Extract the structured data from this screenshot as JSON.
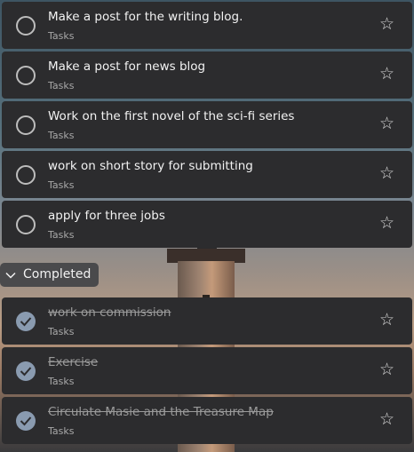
{
  "open_tasks": [
    {
      "title": "Make a post for the writing blog.",
      "list": "Tasks"
    },
    {
      "title": "Make a post for news blog",
      "list": "Tasks"
    },
    {
      "title": "Work on the first novel of the sci-fi series",
      "list": "Tasks"
    },
    {
      "title": "work on short story for submitting",
      "list": "Tasks"
    },
    {
      "title": "apply for three jobs",
      "list": "Tasks"
    }
  ],
  "completed_section": {
    "label": "Completed"
  },
  "completed_tasks": [
    {
      "title": "work on commission",
      "list": "Tasks"
    },
    {
      "title": "Exercise",
      "list": "Tasks"
    },
    {
      "title": "Circulate Masie and the Treasure Map",
      "list": "Tasks"
    }
  ],
  "icons": {
    "incomplete": "empty-circle-icon",
    "complete": "checkmark-circle-icon",
    "importance": "star-outline-icon",
    "toggle": "chevron-down-icon"
  },
  "colors": {
    "card_bg": "#2c2c2e",
    "check_fill": "#8a9bb0"
  }
}
